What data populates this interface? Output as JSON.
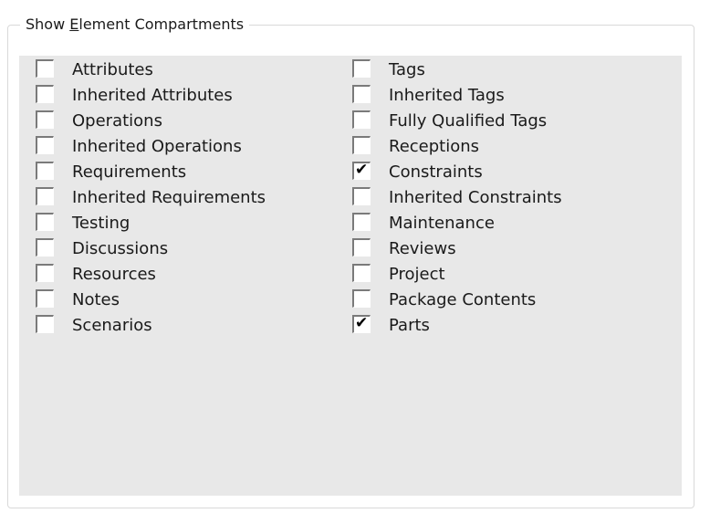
{
  "group": {
    "title_prefix": "Show ",
    "title_mnemonic": "E",
    "title_rest": "lement Compartments"
  },
  "left_items": [
    {
      "label": "Attributes",
      "checked": false
    },
    {
      "label": "Inherited Attributes",
      "checked": false
    },
    {
      "label": "Operations",
      "checked": false
    },
    {
      "label": "Inherited Operations",
      "checked": false
    },
    {
      "label": "Requirements",
      "checked": false
    },
    {
      "label": "Inherited Requirements",
      "checked": false
    },
    {
      "label": "Testing",
      "checked": false
    },
    {
      "label": "Discussions",
      "checked": false
    },
    {
      "label": "Resources",
      "checked": false
    },
    {
      "label": "Notes",
      "checked": false
    },
    {
      "label": "Scenarios",
      "checked": false
    }
  ],
  "right_items": [
    {
      "label": "Tags",
      "checked": false
    },
    {
      "label": "Inherited Tags",
      "checked": false
    },
    {
      "label": "Fully Qualified Tags",
      "checked": false
    },
    {
      "label": "Receptions",
      "checked": false
    },
    {
      "label": "Constraints",
      "checked": true
    },
    {
      "label": "Inherited Constraints",
      "checked": false
    },
    {
      "label": "Maintenance",
      "checked": false
    },
    {
      "label": "Reviews",
      "checked": false
    },
    {
      "label": "Project",
      "checked": false
    },
    {
      "label": "Package Contents",
      "checked": false
    },
    {
      "label": "Parts",
      "checked": true
    }
  ]
}
